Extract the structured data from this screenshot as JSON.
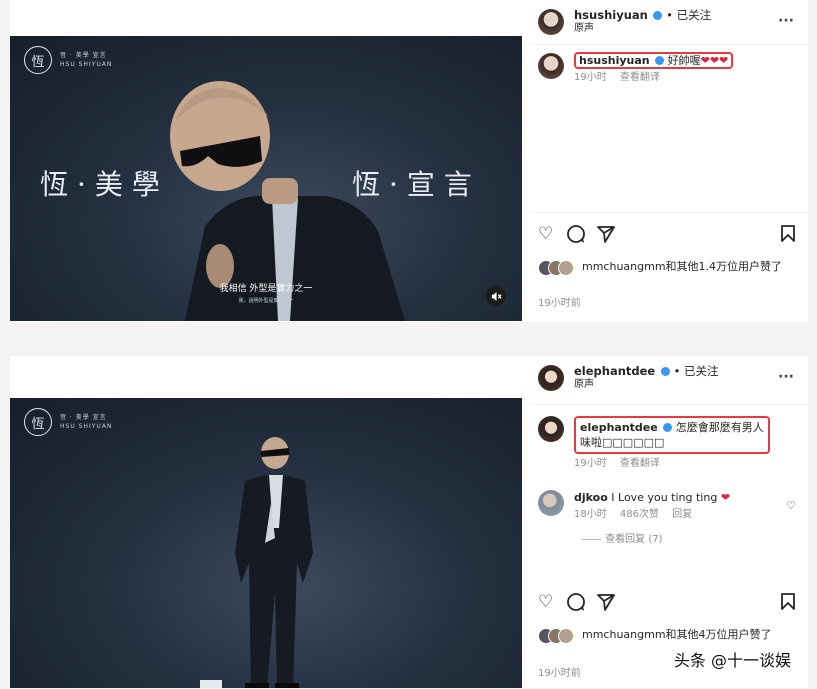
{
  "post1": {
    "video": {
      "brand_logo": "恆",
      "brand_line1": "恆 · 美學 宣言",
      "brand_line2": "HSU SHIYUAN",
      "left_text": "恆·美學",
      "right_text": "恆·宣言",
      "subtitle1": "我相信 外型是實力之一",
      "subtitle2": "我，說明外型是實力之一",
      "mute_icon": "speaker-muted-icon"
    },
    "header": {
      "username": "hsushiyuan",
      "follow_status": "• 已关注",
      "subtitle": "原声",
      "more": "···"
    },
    "comment": {
      "username": "hsushiyuan",
      "text": "好帥喔",
      "hearts": "❤❤❤",
      "time": "19小时",
      "translate": "查看翻译"
    },
    "likes": {
      "text": "mmchuangmm和其他1.4万位用户赞了"
    },
    "time": "19小时前"
  },
  "post2": {
    "video": {
      "brand_logo": "恆",
      "brand_line1": "恆 · 美學 宣言",
      "brand_line2": "HSU SHIYUAN",
      "mute_icon": "speaker-muted-icon"
    },
    "header": {
      "username": "elephantdee",
      "follow_status": "• 已关注",
      "subtitle": "原声",
      "more": "···"
    },
    "comment": {
      "username": "elephantdee",
      "text_line1": "怎麼會那麼有男人",
      "text_line2": "味啦□□□□□□",
      "time": "19小时",
      "translate": "查看翻译"
    },
    "comment2": {
      "username": "djkoo",
      "text": "I Love you ting ting",
      "heart": "❤",
      "time": "18小时",
      "likes": "486次赞",
      "reply": "回复",
      "view_replies": "—— 查看回复 (7)"
    },
    "likes": {
      "text": "mmchuangmm和其他4万位用户赞了"
    },
    "time": "19小时前"
  },
  "watermark": "头条 @十一谈娱",
  "colors": {
    "highlight": "#e53945",
    "verified": "#3897f0",
    "video_bg": "#24303f"
  }
}
